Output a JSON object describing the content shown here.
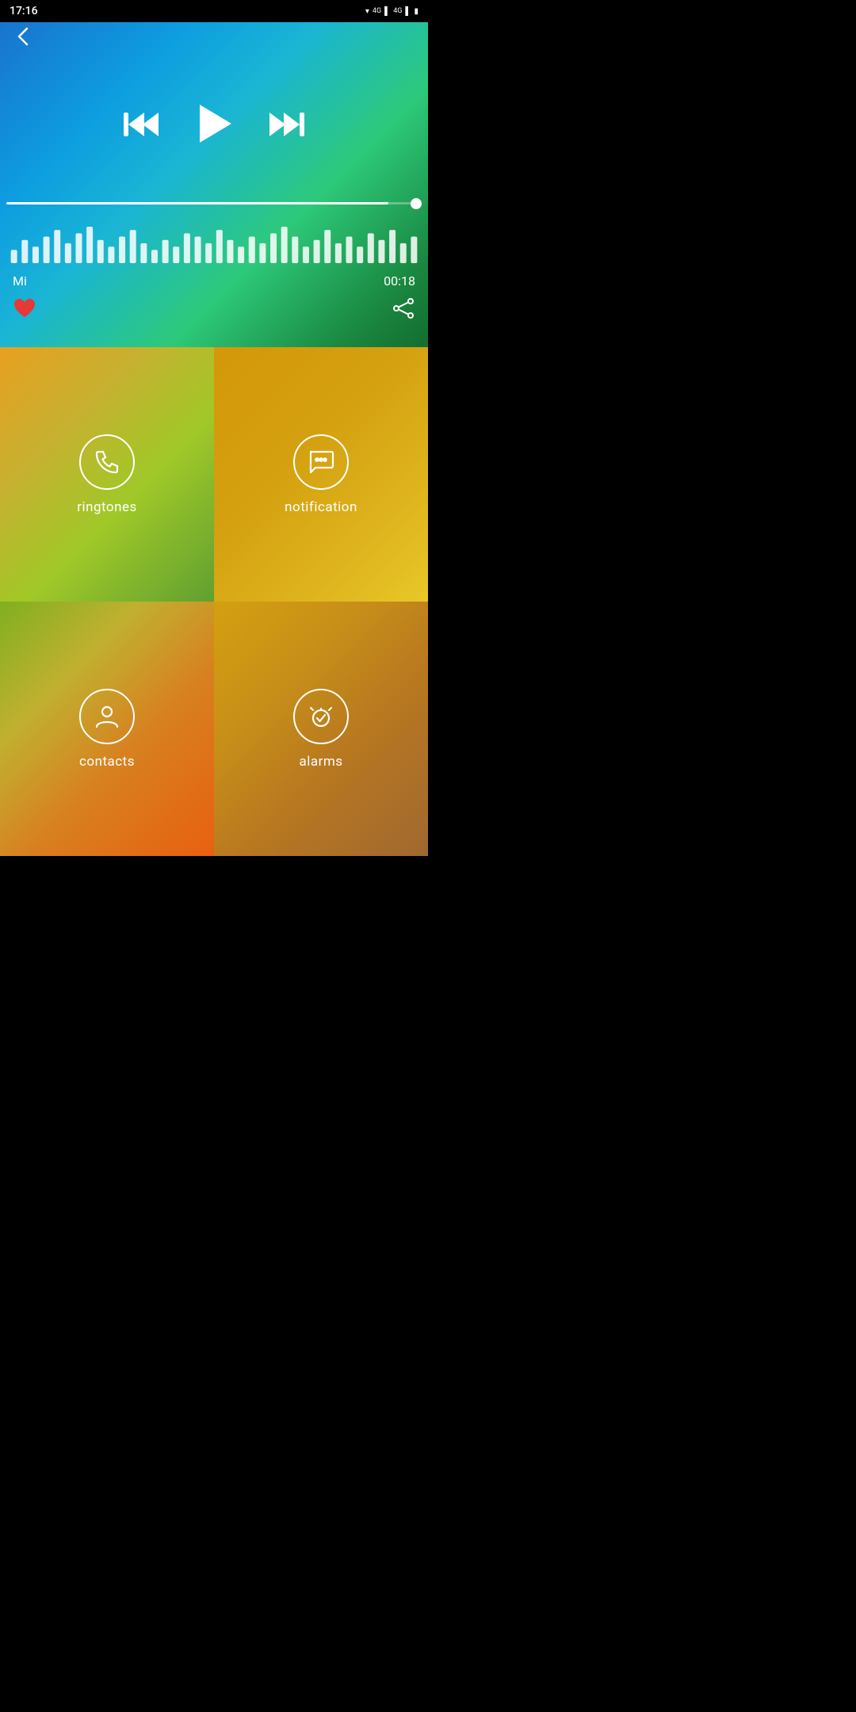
{
  "statusBar": {
    "time": "17:16"
  },
  "player": {
    "backLabel": "‹",
    "trackName": "Mi",
    "duration": "00:18",
    "progressPercent": 92,
    "waveformBars": [
      8,
      14,
      10,
      16,
      20,
      12,
      18,
      22,
      14,
      10,
      16,
      20,
      12,
      8,
      14,
      10,
      18,
      16,
      12,
      20,
      14,
      10,
      16,
      12,
      18,
      22,
      16,
      10,
      14,
      20,
      12,
      16,
      10,
      18,
      14,
      20,
      12,
      16
    ]
  },
  "transport": {
    "rewindLabel": "⏮",
    "playLabel": "▶",
    "forwardLabel": "⏭"
  },
  "actions": {
    "likeLabel": "♥",
    "shareLabel": "share"
  },
  "grid": {
    "ringtones": {
      "label": "ringtones",
      "icon": "phone"
    },
    "notification": {
      "label": "notification",
      "icon": "chat"
    },
    "contacts": {
      "label": "contacts",
      "icon": "person"
    },
    "alarms": {
      "label": "alarms",
      "icon": "alarm"
    }
  }
}
